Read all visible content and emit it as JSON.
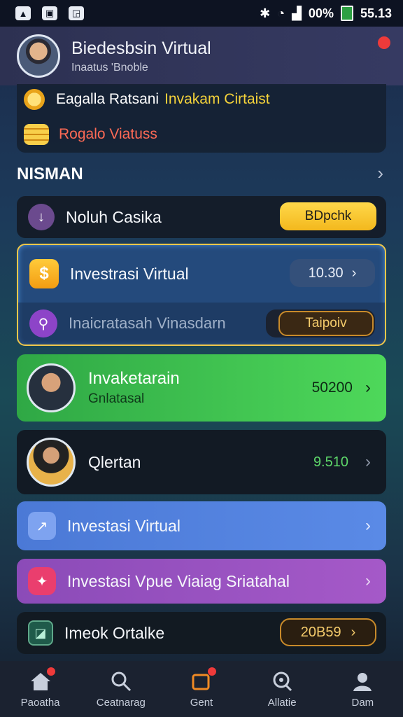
{
  "status_bar": {
    "battery_text": "00%",
    "time": "55.13",
    "left_icons": [
      "a-icon",
      "image-icon",
      "cast-icon"
    ],
    "right_icons": [
      "bluetooth-icon",
      "wifi-icon",
      "signal-icon"
    ]
  },
  "header": {
    "title": "Biedesbsin Virtual",
    "subtitle": "Inaatus 'Bnoble"
  },
  "reward": {
    "line1_white": "Eagalla Ratsani",
    "line1_yellow": "Invakam Cirtaist",
    "line2": "Rogalo Viatuss"
  },
  "section": {
    "title": "NISMAN",
    "chevron": "›"
  },
  "cards": {
    "c1": {
      "label": "Noluh Casika",
      "button": "BDpchk"
    },
    "c2": {
      "label": "Investrasi Virtual",
      "value": "10.30",
      "chevron": "›",
      "sub_label": "Inaicratasah Vinasdarn",
      "sub_button": "Taipoiv"
    },
    "c3": {
      "title": "Invaketarain",
      "subtitle": "Gnlatasal",
      "value": "50200",
      "chevron": "›"
    },
    "c4": {
      "label": "Qlertan",
      "value": "9.510",
      "chevron": "›"
    },
    "c5": {
      "label": "Investasi Virtual",
      "chevron": "›"
    },
    "c6": {
      "label": "Investasi Vpue Viaiag Sriatahal",
      "chevron": "›"
    },
    "c7": {
      "label": "Imeok Ortalke",
      "value": "20B59",
      "chevron": "›"
    }
  },
  "bottom_nav": [
    {
      "label": "Paoatha",
      "icon": "home-icon"
    },
    {
      "label": "Ceatnarag",
      "icon": "search-icon"
    },
    {
      "label": "Gent",
      "icon": "cart-icon"
    },
    {
      "label": "Allatie",
      "icon": "analytics-icon"
    },
    {
      "label": "Dam",
      "icon": "profile-icon"
    }
  ],
  "colors": {
    "accent_yellow": "#f3b81d",
    "green": "#4ed85a",
    "blue": "#5a8ae6",
    "purple": "#a559c8",
    "alert_red": "#ee3a3a"
  }
}
